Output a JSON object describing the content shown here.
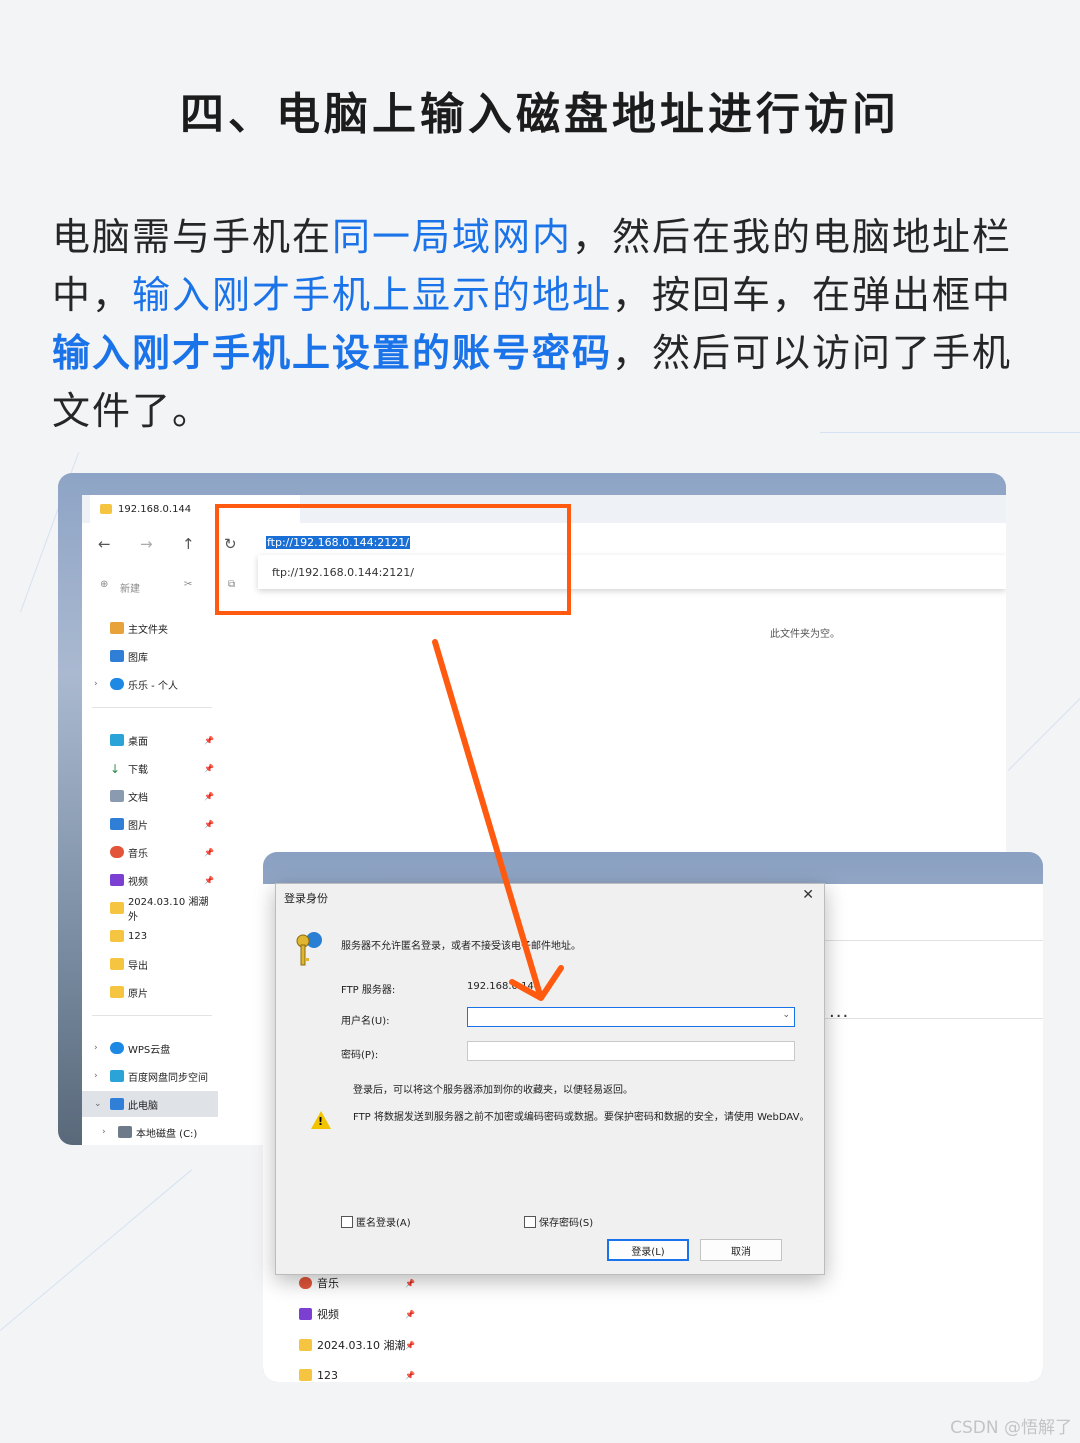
{
  "heading": "四、电脑上输入磁盘地址进行访问",
  "paragraph": {
    "p1": "电脑需与手机在",
    "h1": "同一局域网内",
    "p2": "，然后在我的电脑地址栏中，",
    "h2": "输入刚才手机上显示的地址",
    "p3": "，按回车，在弹出框中",
    "h3": "输入刚才手机上设置的账号密码",
    "p4": "，然后可以访问了手机文件了。"
  },
  "explorer": {
    "tab_title": "192.168.0.144",
    "address_value": "ftp://192.168.0.144:2121/",
    "suggestion": "ftp://192.168.0.144:2121/",
    "new_label": "新建",
    "empty_message": "此文件夹为空。",
    "sidebar": {
      "top": [
        "主文件夹",
        "图库",
        "乐乐 - 个人"
      ],
      "quick": [
        "桌面",
        "下载",
        "文档",
        "图片",
        "音乐",
        "视频",
        "2024.03.10 湘潮外",
        "123",
        "导出",
        "原片"
      ],
      "drives": [
        "WPS云盘",
        "百度网盘同步空间",
        "此电脑",
        "本地磁盘 (C:)"
      ]
    }
  },
  "dialog": {
    "title": "登录身份",
    "close": "✕",
    "message": "服务器不允许匿名登录，或者不接受该电子邮件地址。",
    "ftp_server_label": "FTP 服务器:",
    "ftp_server_value": "192.168.0.144",
    "username_label": "用户名(U):",
    "password_label": "密码(P):",
    "note": "登录后，可以将这个服务器添加到你的收藏夹，以便轻易返回。",
    "warning": "FTP 将数据发送到服务器之前不加密或编码密码或数据。要保护密码和数据的安全，请使用 WebDAV。",
    "anon_login": "匿名登录(A)",
    "save_password": "保存密码(S)",
    "login_button": "登录(L)",
    "cancel_button": "取消"
  },
  "window2": {
    "items": [
      "音乐",
      "视频",
      "2024.03.10 湘潮",
      "123"
    ]
  },
  "colors": {
    "accent": "#1a73e8",
    "highlight": "#ff5a0f"
  },
  "watermark": "CSDN @悟解了"
}
